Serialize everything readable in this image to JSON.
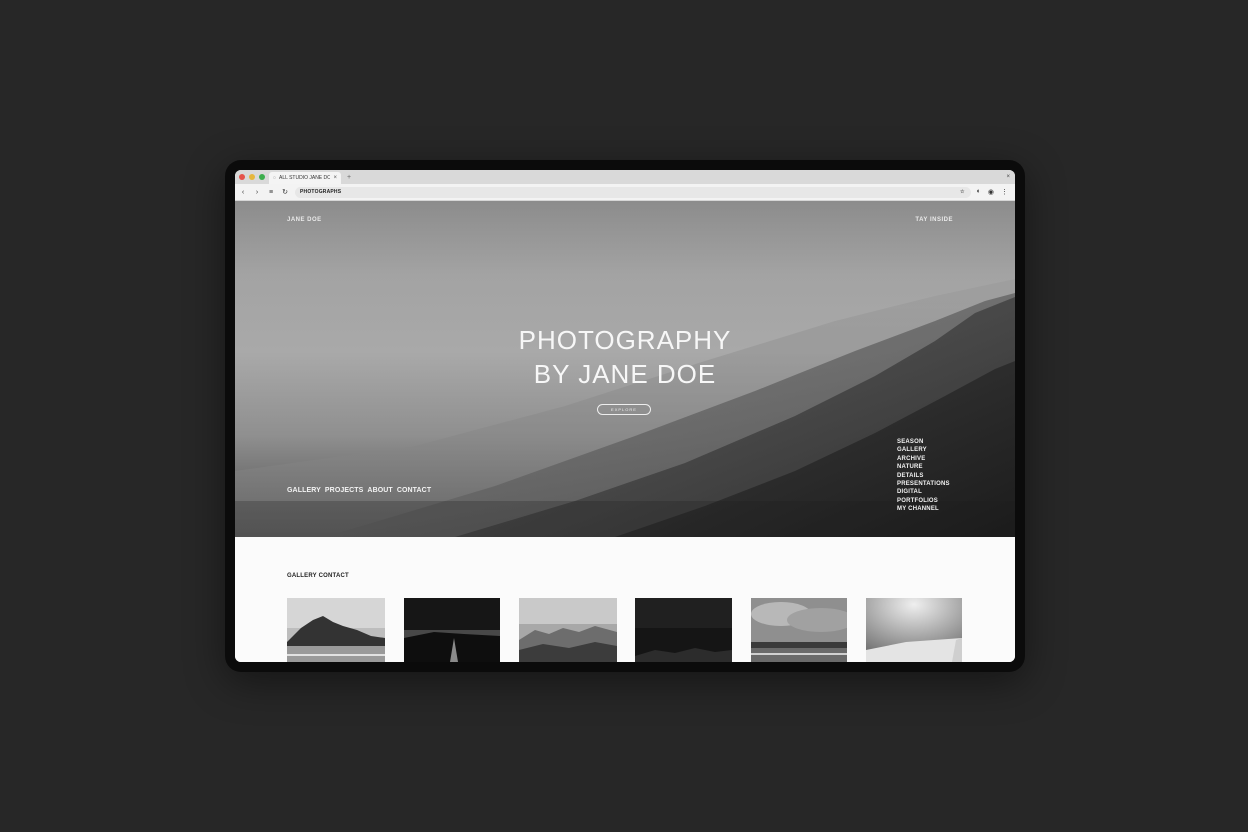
{
  "browser": {
    "traffic_lights": [
      "#e5534b",
      "#e6b73d",
      "#3cae4d"
    ],
    "tab_title": "ALL STUDIO JANE DOE",
    "tab_close": "×",
    "new_tab": "+",
    "window_close": "×",
    "url": "PHOTOGRAPHS",
    "icons": [
      "back-icon",
      "forward-icon",
      "menu-icon",
      "reload-icon",
      "bookmark-icon",
      "extension-icon",
      "account-icon",
      "more-icon"
    ]
  },
  "hero": {
    "brand": "JANE DOE",
    "top_right": "TAY INSIDE",
    "title_line1": "PHOTOGRAPHY",
    "title_line2": "BY JANE DOE",
    "button_label": "EXPLORE",
    "nav": [
      "GALLERY",
      "PROJECTS",
      "ABOUT",
      "CONTACT"
    ],
    "side_menu": [
      "SEASON",
      "GALLERY",
      "ARCHIVE",
      "NATURE",
      "DETAILS",
      "PRESENTATIONS",
      "DIGITAL",
      "PORTFOLIOS",
      "MY CHANNEL"
    ]
  },
  "gallery": {
    "heading": "GALLERY CONTACT",
    "thumbs": [
      "mountain lake",
      "road at dusk",
      "valley hills",
      "dark hills",
      "cloudy shore",
      "light room"
    ]
  },
  "colors": {
    "background": "#272727",
    "device": "#0b0b0b",
    "hero_text": "#f7f7f7"
  }
}
